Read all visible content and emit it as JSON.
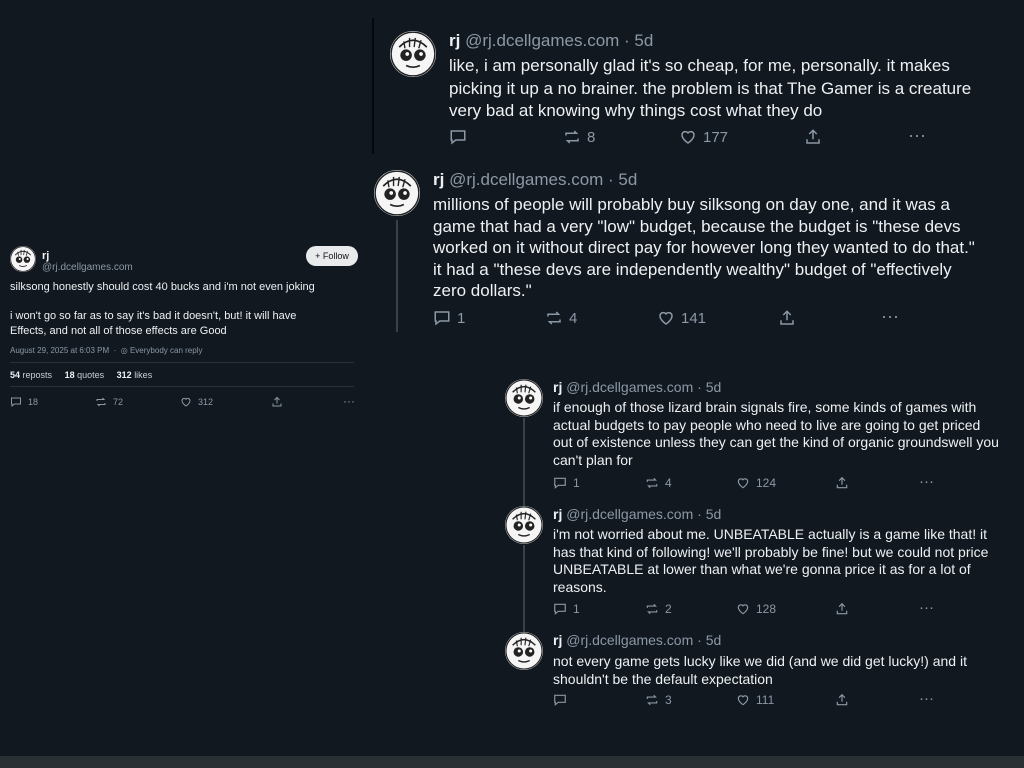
{
  "main_post": {
    "name": "rj",
    "handle": "@rj.dcellgames.com",
    "follow_label": "+ Follow",
    "line1": "silksong honestly should cost 40 bucks and i'm not even joking",
    "line2": "i won't go so far as to say it's bad it doesn't, but! it will have",
    "line3": "Effects, and not all of those effects are Good",
    "date": "August 29, 2025 at 6:03 PM",
    "reply_setting": "Everybody can reply",
    "reposts_count": "54",
    "reposts_label": "reposts",
    "quotes_count": "18",
    "quotes_label": "quotes",
    "likes_count": "312",
    "likes_label": "likes",
    "replies": "18",
    "reposts": "72",
    "likes": "312"
  },
  "reply_a": {
    "name": "rj",
    "meta": "@rj.dcellgames.com · 5d",
    "lines": [
      "like, i am personally glad it's so cheap, for me, personally. it makes",
      "picking it up a no brainer. the problem is that The Gamer is a creature",
      "very bad at knowing why things cost what they do"
    ],
    "replies": "",
    "reposts": "8",
    "likes": "177"
  },
  "reply_b": {
    "name": "rj",
    "meta": "@rj.dcellgames.com · 5d",
    "lines": [
      "millions of people will probably buy silksong on day one, and it was a",
      "game that had a very \"low\" budget, because the budget is \"these devs",
      "worked on it without direct pay for however long they wanted to do that.\"",
      "it had a \"these devs are independently wealthy\" budget of \"effectively",
      "zero dollars.\""
    ],
    "replies": "1",
    "reposts": "4",
    "likes": "141"
  },
  "thread": [
    {
      "name": "rj",
      "meta": "@rj.dcellgames.com · 5d",
      "lines": [
        "if enough of those lizard brain signals fire, some kinds of games with",
        "actual budgets to pay people who need to live are going to get priced",
        "out of existence unless they can get the kind of organic groundswell you",
        "can't plan for"
      ],
      "replies": "1",
      "reposts": "4",
      "likes": "124"
    },
    {
      "name": "rj",
      "meta": "@rj.dcellgames.com · 5d",
      "lines": [
        "i'm not worried about me. UNBEATABLE actually is a game like that! it",
        "has that kind of following! we'll probably be fine! but we could not price",
        "UNBEATABLE at lower than what we're gonna price it as for a lot of",
        "reasons."
      ],
      "replies": "1",
      "reposts": "2",
      "likes": "128"
    },
    {
      "name": "rj",
      "meta": "@rj.dcellgames.com · 5d",
      "lines": [
        "not every game gets lucky like we did (and we did get lucky!) and it",
        "shouldn't be the default expectation"
      ],
      "replies": "",
      "reposts": "3",
      "likes": "111"
    }
  ],
  "icons": {
    "reply": "speech-bubble-icon",
    "repost": "repost-arrows-icon",
    "like": "heart-icon",
    "share": "share-upload-icon",
    "more": "ellipsis-icon",
    "avatar": "doodle-face-avatar",
    "reply_setting": "globe-icon"
  },
  "colors": {
    "background": "#111820",
    "text": "#eef1f3",
    "muted": "#8b98a5"
  }
}
